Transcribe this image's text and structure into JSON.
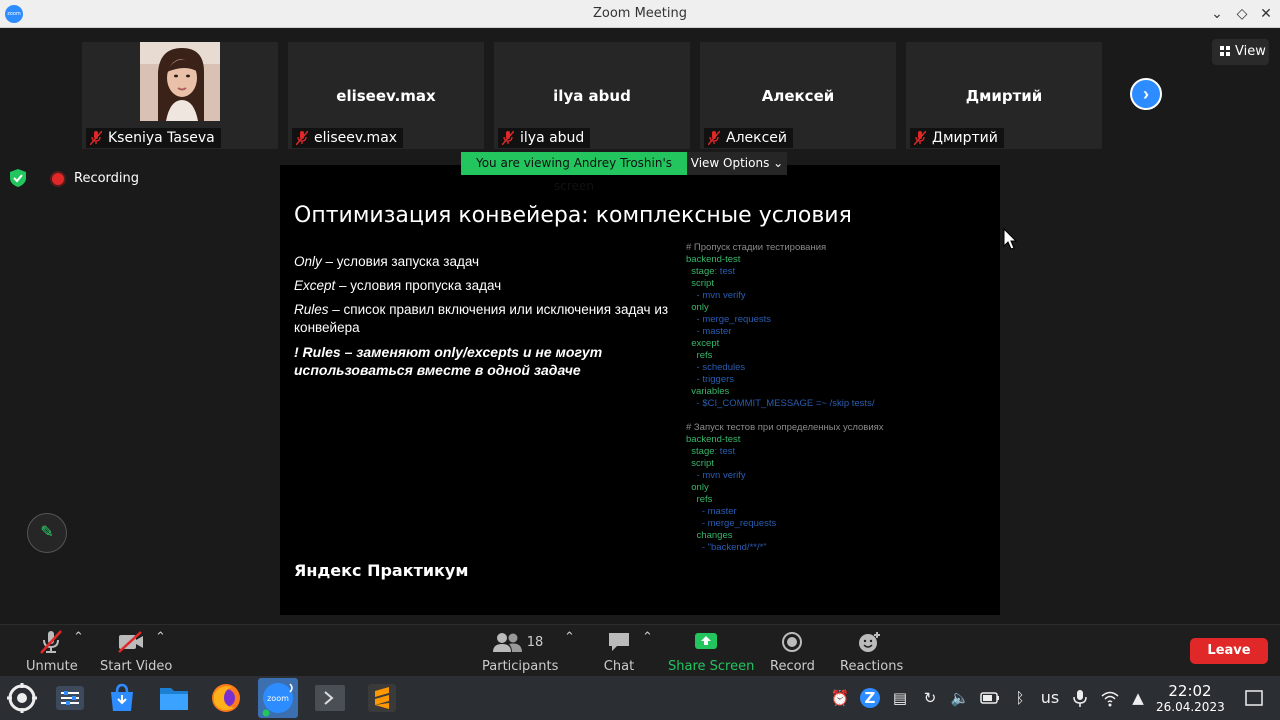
{
  "window": {
    "app_icon_label": "zoom",
    "title": "Zoom Meeting"
  },
  "participants_strip": [
    {
      "name": "Kseniya Taseva",
      "display": ""
    },
    {
      "name": "eliseev.max",
      "display": "eliseev.max"
    },
    {
      "name": "ilya abud",
      "display": "ilya abud"
    },
    {
      "name": "Алексей",
      "display": "Алексей"
    },
    {
      "name": "Дмиртий",
      "display": "Дмиртий"
    }
  ],
  "view_button": {
    "label": "View"
  },
  "recording": {
    "label": "Recording"
  },
  "share_banner": {
    "viewing_text": "You are viewing Andrey Troshin's screen",
    "view_options_label": "View Options"
  },
  "slide": {
    "title": "Оптимизация конвейера: комплексные условия",
    "lines": [
      {
        "term": "Only",
        "text": " – условия запуска задач"
      },
      {
        "term": "Except",
        "text": " – условия пропуска задач"
      },
      {
        "term": "Rules",
        "text": " – список правил включения или исключения задач из конвейера"
      }
    ],
    "warning": "! Rules – заменяют only/excepts и не могут использоваться вместе в одной задаче",
    "brand": "Яндекс Практикум",
    "code": [
      {
        "cls": "c",
        "text": "# Пропуск стадии тестирования"
      },
      {
        "cls": "g",
        "text": "backend-test"
      },
      {
        "cls": "g",
        "text": "  stage",
        "extra": ": test"
      },
      {
        "cls": "g",
        "text": "  script"
      },
      {
        "cls": "b",
        "text": "    - mvn verify"
      },
      {
        "cls": "g",
        "text": "  only"
      },
      {
        "cls": "b",
        "text": "    - merge_requests"
      },
      {
        "cls": "b",
        "text": "    - master"
      },
      {
        "cls": "g",
        "text": "  except"
      },
      {
        "cls": "g",
        "text": "    refs"
      },
      {
        "cls": "b",
        "text": "    - schedules"
      },
      {
        "cls": "b",
        "text": "    - triggers"
      },
      {
        "cls": "g",
        "text": "  variables"
      },
      {
        "cls": "b",
        "text": "    - $CI_COMMIT_MESSAGE =~ /skip tests/"
      },
      {
        "cls": "c",
        "text": ""
      },
      {
        "cls": "c",
        "text": "# Запуск тестов при определенных условиях"
      },
      {
        "cls": "g",
        "text": "backend-test"
      },
      {
        "cls": "g",
        "text": "  stage",
        "extra": ": test"
      },
      {
        "cls": "g",
        "text": "  script"
      },
      {
        "cls": "b",
        "text": "    - mvn verify"
      },
      {
        "cls": "g",
        "text": "  only"
      },
      {
        "cls": "g",
        "text": "    refs"
      },
      {
        "cls": "b",
        "text": "      - master"
      },
      {
        "cls": "b",
        "text": "      - merge_requests"
      },
      {
        "cls": "g",
        "text": "    changes"
      },
      {
        "cls": "b",
        "text": "      - \"backend/**/*\""
      }
    ]
  },
  "toolbar": {
    "unmute": "Unmute",
    "start_video": "Start Video",
    "participants": "Participants",
    "participants_count": "18",
    "chat": "Chat",
    "share_screen": "Share Screen",
    "record": "Record",
    "reactions": "Reactions",
    "leave": "Leave"
  },
  "taskbar": {
    "apps": [
      "app-launcher",
      "settings",
      "store",
      "files",
      "firefox",
      "zoom",
      "terminal",
      "sublime-text"
    ],
    "keyboard_layout": "us",
    "time": "22:02",
    "date": "26.04.2023"
  },
  "colors": {
    "zoom_blue": "#2d8cff",
    "share_green": "#23c55e",
    "leave_red": "#e02828"
  }
}
